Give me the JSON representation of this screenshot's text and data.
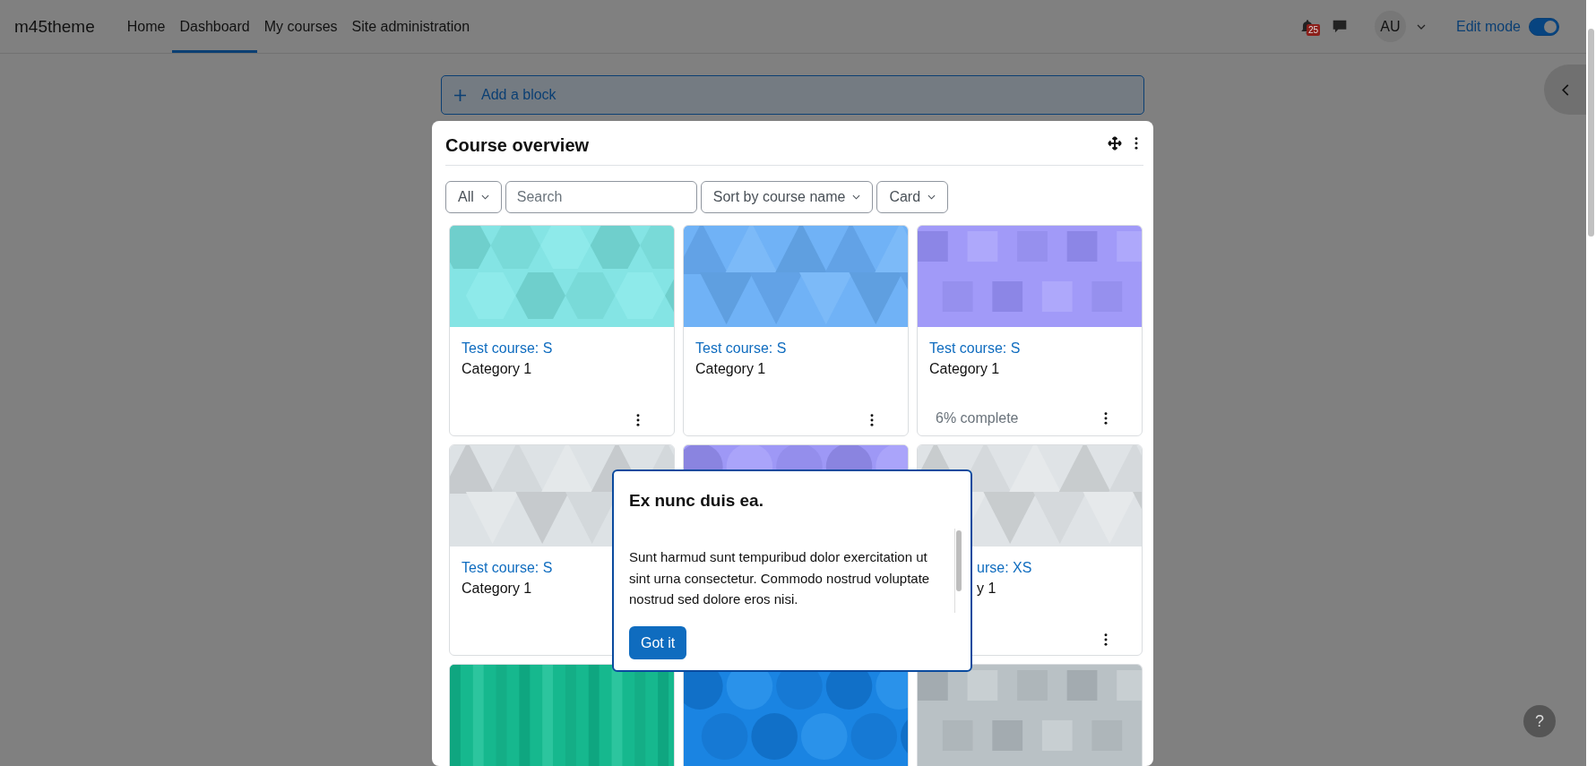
{
  "navbar": {
    "brand": "m45theme",
    "items": [
      {
        "label": "Home",
        "selected": false
      },
      {
        "label": "Dashboard",
        "selected": true
      },
      {
        "label": "My courses",
        "selected": false
      },
      {
        "label": "Site administration",
        "selected": false
      }
    ],
    "notification_count": "25",
    "user_initials": "AU",
    "edit_mode": {
      "label": "Edit mode",
      "on": true
    }
  },
  "page": {
    "add_block": "Add a block"
  },
  "course_overview": {
    "title": "Course overview",
    "filters": {
      "grouping": "All",
      "search": {
        "placeholder": "Search"
      },
      "sort": "Sort by course name",
      "view": "Card"
    },
    "courses": [
      {
        "name": "Test course: S",
        "category": "Category 1",
        "menu_button": true
      },
      {
        "name": "Test course: S",
        "category": "Category 1",
        "menu_button": true
      },
      {
        "name": "Test course: S",
        "category": "Category 1",
        "progress": "6% complete",
        "menu_button": true
      },
      {
        "name": "Test course: S",
        "category": "Category 1"
      },
      {
        "kind": "picture"
      },
      {
        "name": "urse: XS",
        "category": "y 1",
        "menu_button": true
      },
      {
        "kind": "picture"
      },
      {
        "kind": "picture"
      },
      {
        "kind": "picture"
      }
    ]
  },
  "tour_step": {
    "title": "Ex nunc duis ea.",
    "body": "Sunt harmud sunt tempuribud dolor exercitation ut sint urna consectetur. Commodo nostrud voluptate nostrud sed dolore eros nisi.",
    "button": "Got it"
  },
  "help_button": "?"
}
